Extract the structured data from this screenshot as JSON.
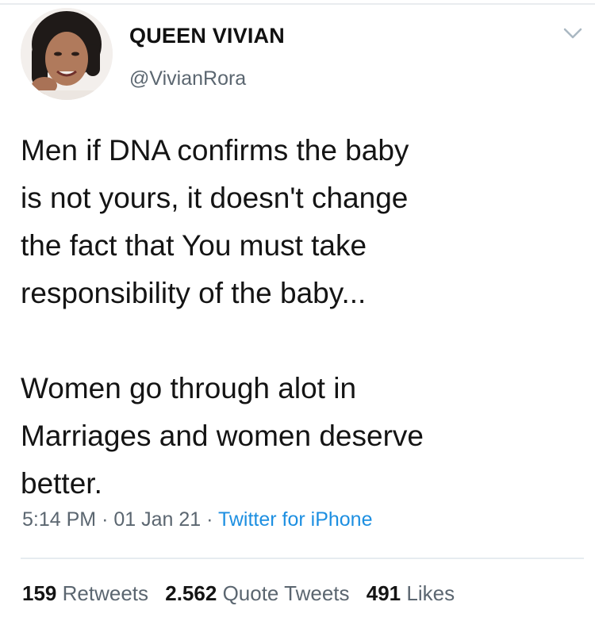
{
  "user": {
    "display_name": "QUEEN VIVIAN",
    "handle": "@VivianRora",
    "avatar_icon": "profile-photo"
  },
  "tweet": {
    "text": "Men if DNA confirms the baby\nis not yours, it doesn't change\nthe fact that  You must take\nresponsibility of the baby...\n\nWomen go through alot in\nMarriages and women deserve\nbetter.",
    "time": "5:14 PM",
    "date": "01 Jan 21",
    "separator": "·",
    "source": "Twitter for iPhone"
  },
  "stats": {
    "retweets_count": "159",
    "retweets_label": "Retweets",
    "quotes_count": "2.562",
    "quotes_label": "Quote Tweets",
    "likes_count": "491",
    "likes_label": "Likes"
  },
  "colors": {
    "link": "#1d8fe1",
    "muted": "#5b6670",
    "text": "#141414"
  },
  "icons": {
    "menu": "chevron-down-icon"
  }
}
